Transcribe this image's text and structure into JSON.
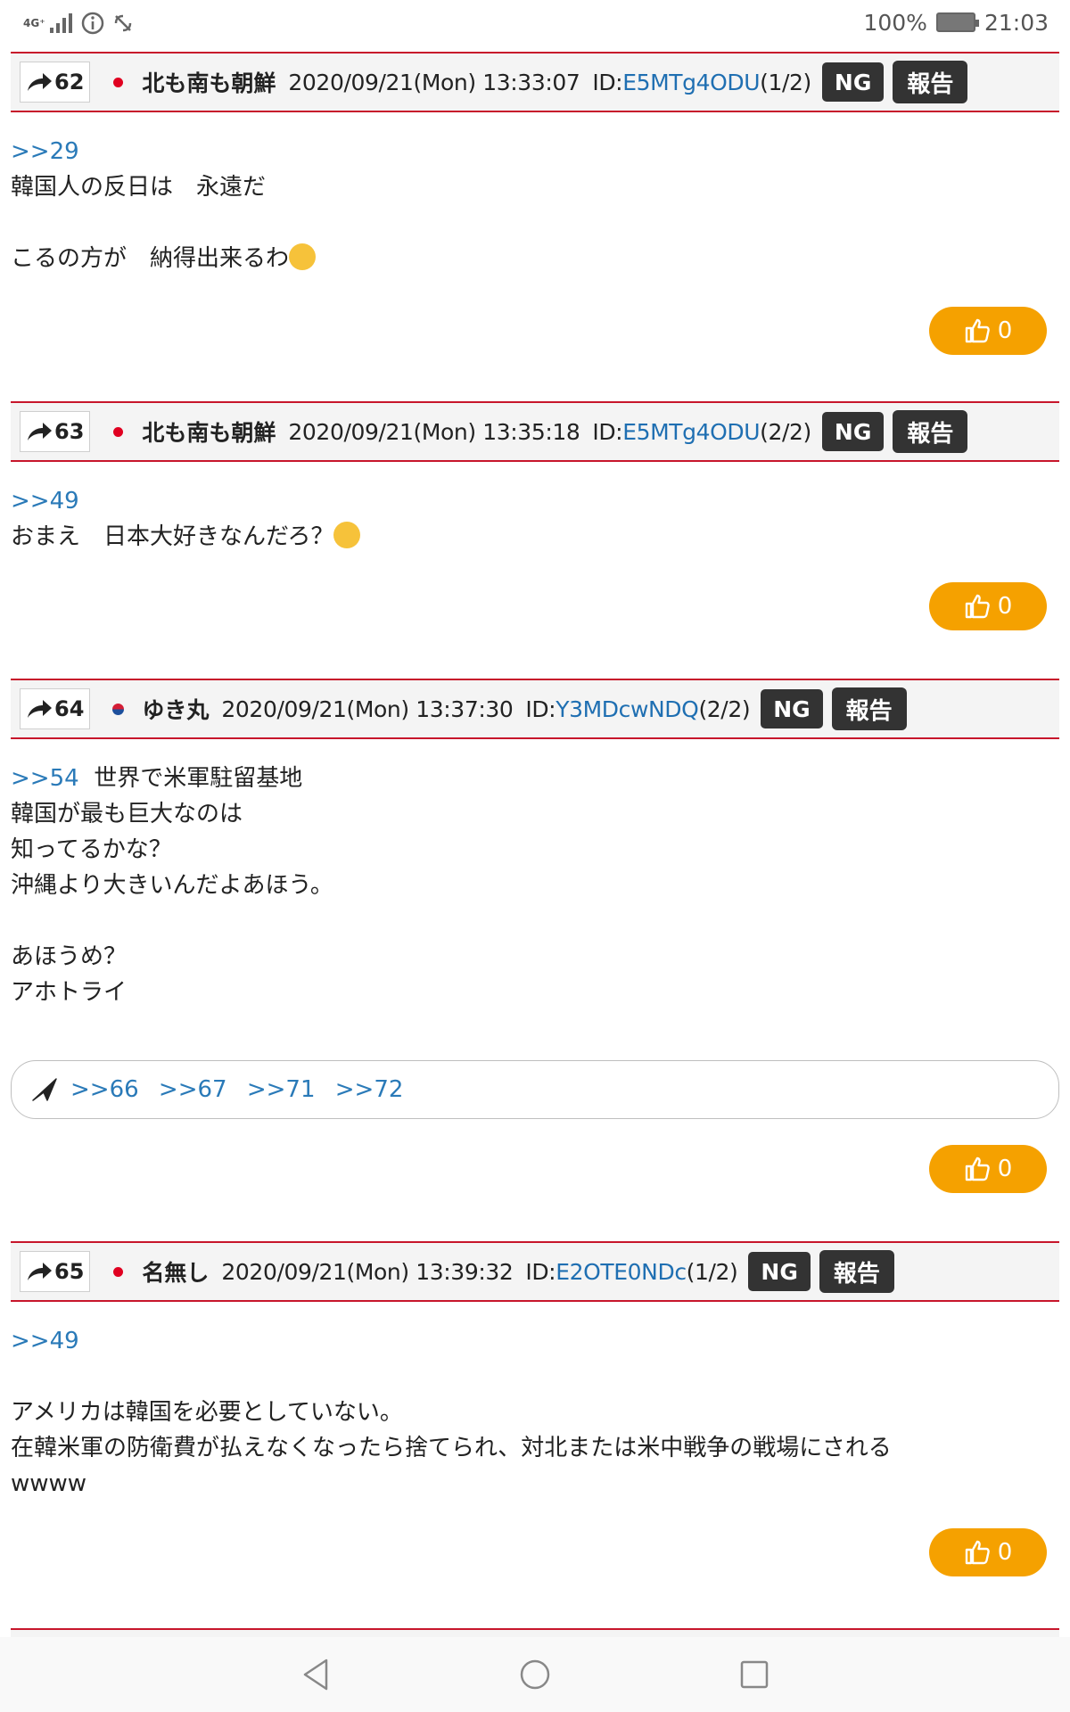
{
  "status_bar": {
    "network": "4G⁺",
    "battery_percent": "100%",
    "time": "21:03",
    "icons": [
      "signal-icon",
      "info-icon",
      "vibrate-icon",
      "battery-icon"
    ]
  },
  "posts": [
    {
      "number": "62",
      "flag": "jp",
      "name": "北も南も朝鮮",
      "datetime": "2020/09/21(Mon) 13:33:07",
      "id_prefix": "ID:",
      "id": "E5MTg4ODU",
      "id_count": "(1/2)",
      "ng_label": "NG",
      "report_label": "報告",
      "anchor": ">>29",
      "lines": [
        "韓国人の反日は　永遠だ",
        "",
        "こるの方が　納得出来るわ"
      ],
      "emoji": "rofl-emoji",
      "like_count": "0"
    },
    {
      "number": "63",
      "flag": "jp",
      "name": "北も南も朝鮮",
      "datetime": "2020/09/21(Mon) 13:35:18",
      "id_prefix": "ID:",
      "id": "E5MTg4ODU",
      "id_count": "(2/2)",
      "ng_label": "NG",
      "report_label": "報告",
      "anchor": ">>49",
      "lines": [
        "おまえ　日本大好きなんだろ？"
      ],
      "emoji": "hand-over-mouth-emoji",
      "like_count": "0"
    },
    {
      "number": "64",
      "flag": "kr",
      "name": "ゆき丸",
      "datetime": "2020/09/21(Mon) 13:37:30",
      "id_prefix": "ID:",
      "id": "Y3MDcwNDQ",
      "id_count": "(2/2)",
      "ng_label": "NG",
      "report_label": "報告",
      "anchor": ">>54",
      "first_line_rest": "世界で米軍駐留基地",
      "lines": [
        "韓国が最も巨大なのは",
        "知ってるかな？",
        "沖縄より大きいんだよあほう。",
        "",
        "あほうめ？",
        "アホトライ"
      ],
      "replies": [
        ">>66",
        ">>67",
        ">>71",
        ">>72"
      ],
      "like_count": "0"
    },
    {
      "number": "65",
      "flag": "jp",
      "name": "名無し",
      "datetime": "2020/09/21(Mon) 13:39:32",
      "id_prefix": "ID:",
      "id": "E2OTE0NDc",
      "id_count": "(1/2)",
      "ng_label": "NG",
      "report_label": "報告",
      "anchor": ">>49",
      "lines": [
        "",
        "アメリカは韓国を必要としていない。",
        "在韓米軍の防衛費が払えなくなったら捨てられ、対北または米中戦争の戦場にされる",
        "wwww"
      ],
      "like_count": "0"
    }
  ],
  "nav": {
    "icons": [
      "back-icon",
      "home-icon",
      "recents-icon"
    ]
  },
  "colors": {
    "accent_red": "#c7162b",
    "like_orange": "#f5a100",
    "link_blue": "#2a7ab8"
  }
}
